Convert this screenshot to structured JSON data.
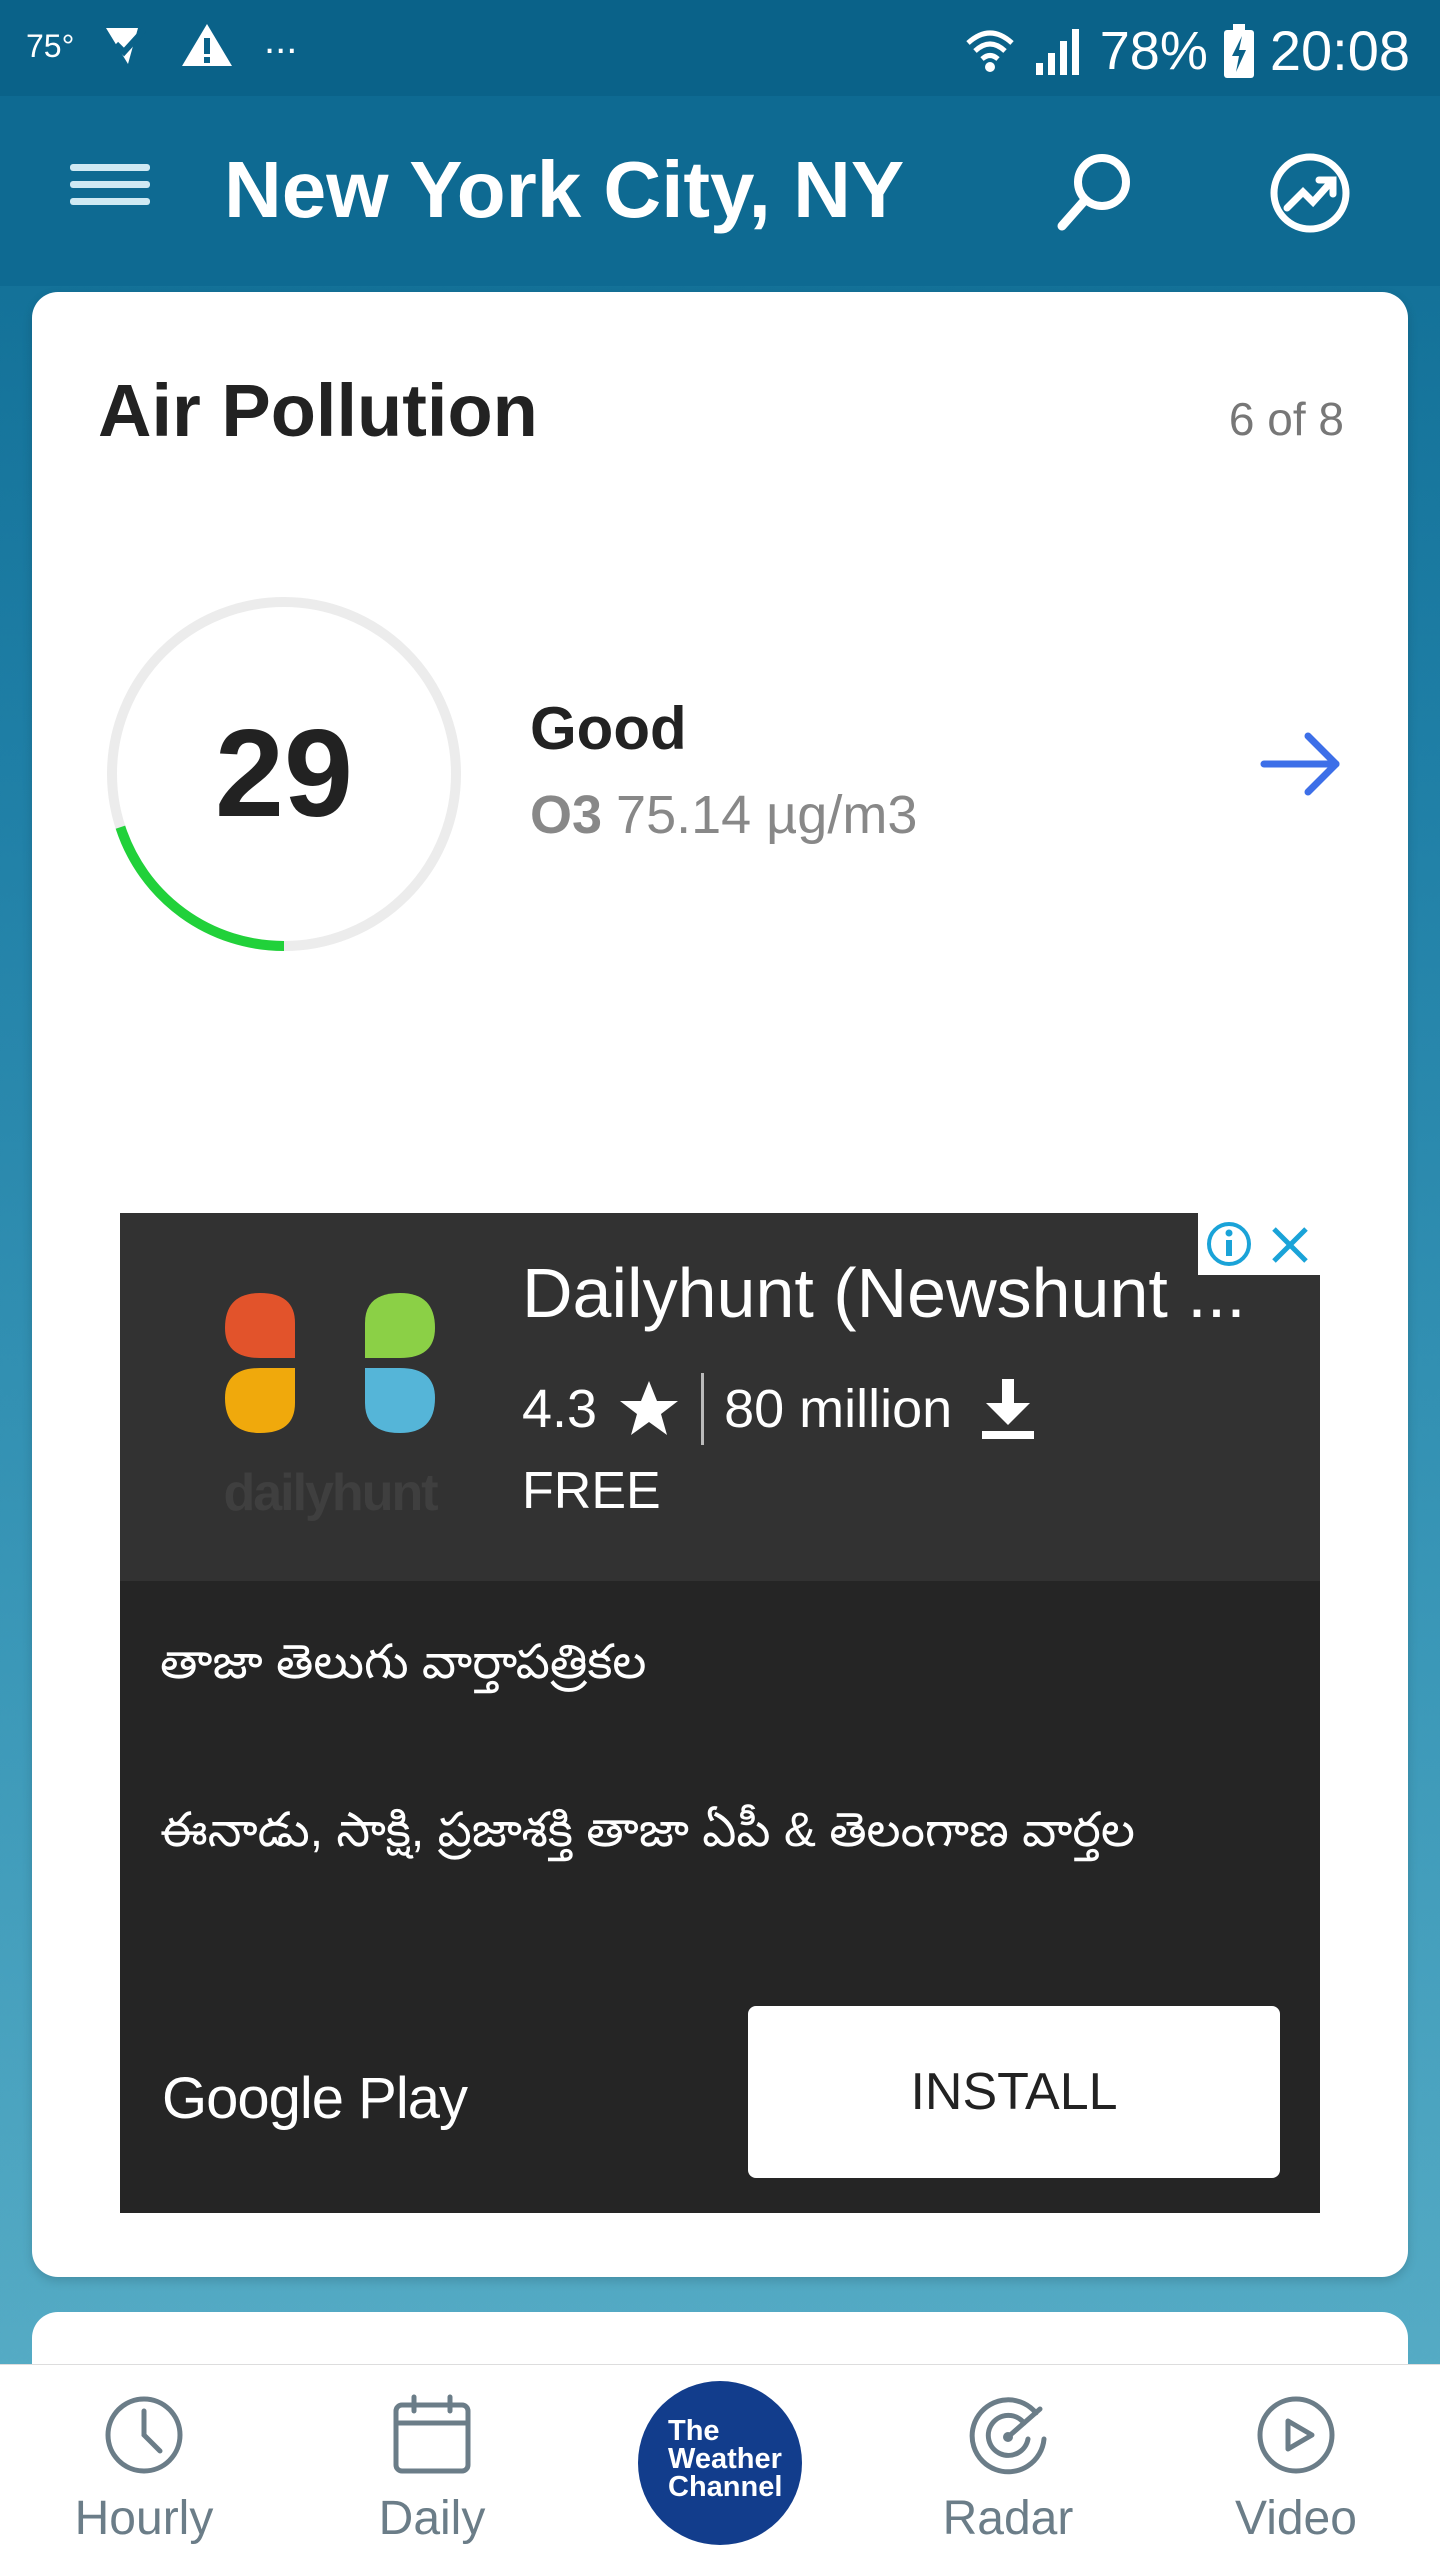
{
  "status_bar": {
    "temperature": "75°",
    "battery": "78%",
    "time": "20:08",
    "more": "..."
  },
  "app_bar": {
    "title": "New York City, NY",
    "icons": [
      "menu-icon",
      "search-icon",
      "trending-icon"
    ]
  },
  "card": {
    "title": "Air Pollution",
    "count": "6 of 8",
    "aqi_value": "29",
    "aqi_fraction": 0.2,
    "aqi_color": "#21d13a",
    "aqi_label": "Good",
    "pollutant": "O3",
    "concentration": "75.14 µg/m3"
  },
  "ad": {
    "logo_text": "dailyhunt",
    "app_name": "Dailyhunt (Newshunt ...",
    "rating": "4.3",
    "downloads": "80 million",
    "price": "FREE",
    "line1": "తాజా తెలుగు వార్తాపత్రికల",
    "line2": "ఈనాడు, సాక్షి, ప్రజాశక్తి తాజా ఏపీ & తెలంగాణ వార్తల",
    "store": "Google Play",
    "install_label": "INSTALL"
  },
  "bottom_nav": {
    "items": [
      {
        "label": "Hourly",
        "icon": "clock-icon"
      },
      {
        "label": "Daily",
        "icon": "calendar-icon"
      },
      {
        "label": "Radar",
        "icon": "radar-icon"
      },
      {
        "label": "Video",
        "icon": "play-icon"
      }
    ],
    "center_logo_lines": [
      "The",
      "Weather",
      "Channel"
    ]
  },
  "colors": {
    "app_bar": "#0e6a92",
    "status_bar": "#0a6289",
    "accent_arrow": "#3d6fe8",
    "twc_logo": "#123d8c"
  }
}
